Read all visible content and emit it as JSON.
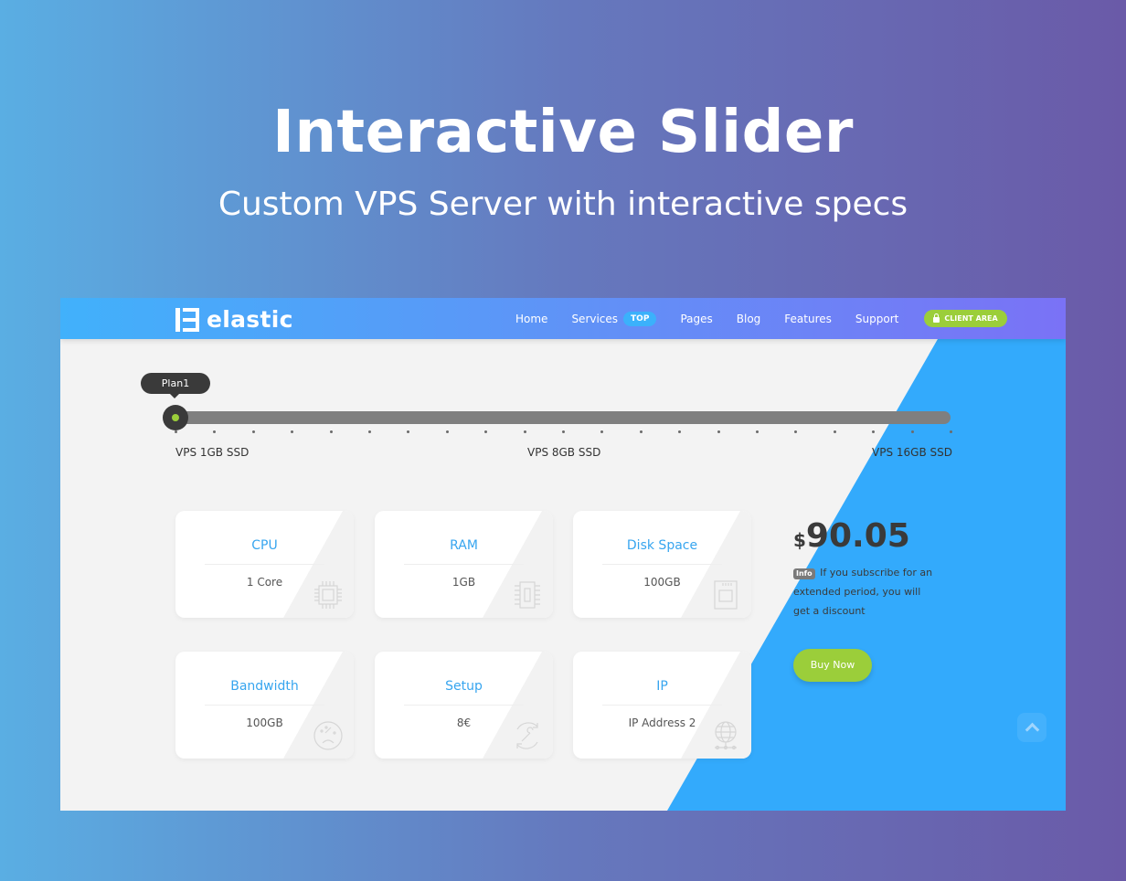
{
  "hero": {
    "title": "Interactive Slider",
    "subtitle": "Custom VPS Server with interactive specs"
  },
  "navbar": {
    "logo_text": "elastic",
    "items": [
      {
        "label": "Home"
      },
      {
        "label": "Services",
        "badge": "TOP"
      },
      {
        "label": "Pages"
      },
      {
        "label": "Blog"
      },
      {
        "label": "Features"
      },
      {
        "label": "Support"
      }
    ],
    "client_area_label": "CLIENT AREA"
  },
  "slider": {
    "tooltip": "Plan1",
    "current_step": 1,
    "total_steps": 21,
    "value_fraction": 0,
    "labels": {
      "min": "VPS 1GB SSD",
      "mid": "VPS 8GB SSD",
      "max": "VPS 16GB SSD"
    }
  },
  "specs": [
    {
      "title": "CPU",
      "value": "1 Core",
      "icon": "cpu-chip-icon"
    },
    {
      "title": "RAM",
      "value": "1GB",
      "icon": "ram-module-icon"
    },
    {
      "title": "Disk Space",
      "value": "100GB",
      "icon": "sd-card-icon"
    },
    {
      "title": "Bandwidth",
      "value": "100GB",
      "icon": "speedometer-icon"
    },
    {
      "title": "Setup",
      "value": "8€",
      "icon": "wrench-refresh-icon"
    },
    {
      "title": "IP",
      "value": "IP Address 2",
      "icon": "globe-network-icon"
    }
  ],
  "pricing": {
    "currency": "$",
    "amount": "90.05",
    "info_badge": "Info",
    "info_text": "If you subscribe for an extended period, you will get a discount",
    "buy_label": "Buy Now"
  },
  "colors": {
    "accent_blue": "#33aafc",
    "accent_green": "#9bce3a",
    "title_blue": "#37a5ef",
    "dark": "#3a3a3a"
  }
}
